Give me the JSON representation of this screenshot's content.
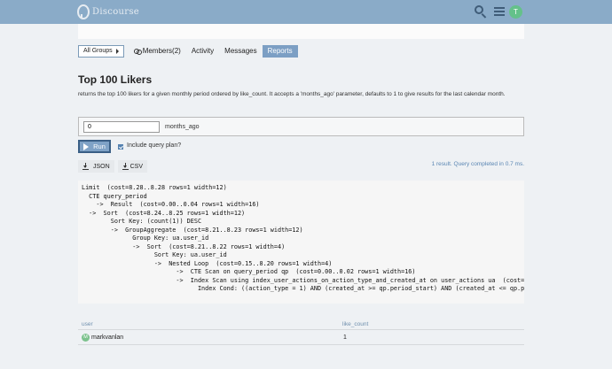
{
  "header": {
    "logo_text": "Discourse",
    "user_initial": "T",
    "avatar_color": "#64c18a",
    "accent_color": "#8aabc8"
  },
  "tabs": {
    "dropdown_label": "All Groups",
    "members": "Members(2)",
    "activity": "Activity",
    "messages": "Messages",
    "reports": "Reports",
    "active_tab": "Reports"
  },
  "report": {
    "title": "Top 100 Likers",
    "description": "returns the top 100 likers for a given monthly period ordered by like_count. It accepts a 'months_ago' parameter, defaults to 1 to give results for the last calendar month."
  },
  "params": {
    "months_ago_value": "0",
    "months_ago_label": "months_ago"
  },
  "controls": {
    "run_label": "Run",
    "query_plan_label": "Include query plan?",
    "query_plan_checked": true,
    "json_label": "JSON",
    "csv_label": "CSV"
  },
  "result_info": "1 result. Query completed in 0.7 ms.",
  "query_plan": [
    "Limit  (cost=8.28..8.28 rows=1 width=12)",
    "  CTE query_period",
    "    ->  Result  (cost=0.00..0.04 rows=1 width=16)",
    "  ->  Sort  (cost=8.24..8.25 rows=1 width=12)",
    "        Sort Key: (count(1)) DESC",
    "        ->  GroupAggregate  (cost=8.21..8.23 rows=1 width=12)",
    "              Group Key: ua.user_id",
    "              ->  Sort  (cost=8.21..8.22 rows=1 width=4)",
    "                    Sort Key: ua.user_id",
    "                    ->  Nested Loop  (cost=0.15..8.20 rows=1 width=4)",
    "                          ->  CTE Scan on query_period qp  (cost=0.00..0.02 rows=1 width=16)",
    "                          ->  Index Scan using index_user_actions_on_action_type_and_created_at on user_actions ua  (cost=",
    "                                Index Cond: ((action_type = 1) AND (created_at >= qp.period_start) AND (created_at <= qp.p"
  ],
  "results": {
    "columns": [
      "user",
      "like_count"
    ],
    "rows": [
      {
        "user_initial": "M",
        "user": "markvanlan",
        "like_count": "1"
      }
    ]
  }
}
